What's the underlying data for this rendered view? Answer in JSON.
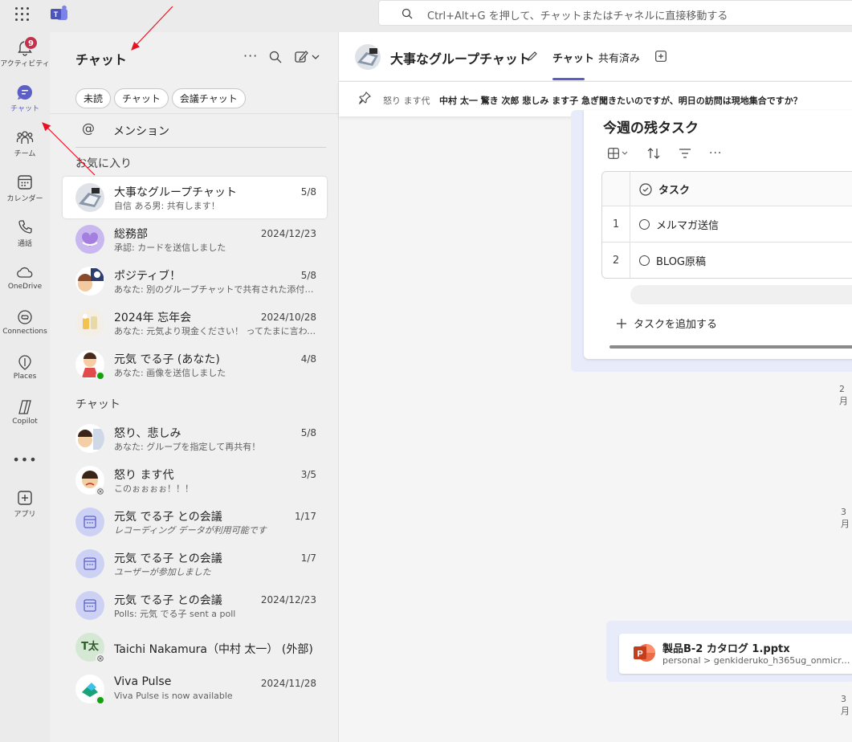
{
  "search": {
    "placeholder": "Ctrl+Alt+G を押して、チャットまたはチャネルに直接移動する"
  },
  "rail": {
    "activity": {
      "label": "アクティビティ",
      "badge": "9"
    },
    "chat": {
      "label": "チャット"
    },
    "teams": {
      "label": "チーム"
    },
    "calendar": {
      "label": "カレンダー"
    },
    "calls": {
      "label": "通話"
    },
    "onedrive": {
      "label": "OneDrive"
    },
    "connections": {
      "label": "Connections"
    },
    "places": {
      "label": "Places"
    },
    "copilot": {
      "label": "Copilot"
    },
    "more": "•••",
    "apps": {
      "label": "アプリ"
    }
  },
  "chatpane": {
    "title": "チャット",
    "filters": [
      "未読",
      "チャット",
      "会議チャット"
    ],
    "mention": "メンション",
    "favorites_label": "お気に入り",
    "chats_label": "チャット",
    "favorites": [
      {
        "name": "大事なグループチャット",
        "date": "5/8",
        "preview": "自信 ある男: 共有します！"
      },
      {
        "name": "総務部",
        "date": "2024/12/23",
        "preview": "承認: カードを送信しました"
      },
      {
        "name": "ポジティブ！",
        "date": "5/8",
        "preview": "あなた: 別のグループチャットで共有された添付ファイ..."
      },
      {
        "name": "2024年 忘年会",
        "date": "2024/10/28",
        "preview": "あなた: 元気より現金ください！ ってたまに言われる..."
      },
      {
        "name": "元気 でる子 (あなた)",
        "date": "4/8",
        "preview": "あなた: 画像を送信しました"
      }
    ],
    "chats": [
      {
        "name": "怒り、悲しみ",
        "date": "5/8",
        "preview": "あなた: グループを指定して再共有！"
      },
      {
        "name": "怒り ます代",
        "date": "3/5",
        "preview": "このぉぉぉぉ！！！"
      },
      {
        "name": "元気 でる子 との会議",
        "date": "1/17",
        "preview": "レコーディング データが利用可能です"
      },
      {
        "name": "元気 でる子 との会議",
        "date": "1/7",
        "preview": "ユーザーが参加しました"
      },
      {
        "name": "元気 でる子 との会議",
        "date": "2024/12/23",
        "preview": "Polls: 元気 でる子 sent a poll"
      },
      {
        "name": "Taichi Nakamura（中村 太一） (外部)",
        "date": "",
        "preview": "",
        "initials": "T太"
      },
      {
        "name": "Viva Pulse",
        "date": "2024/11/28",
        "preview": "Viva Pulse is now available"
      }
    ]
  },
  "main": {
    "title": "大事なグループチャット",
    "tabs": [
      "チャット",
      "共有済み"
    ],
    "pinned": {
      "sender": "怒り ます代",
      "text": "中村 太一 驚き 次郎 悲しみ ます子 急ぎ聞きたいのですが、明日の訪問は現地集合ですか？"
    },
    "loop": {
      "title": "今週の残タスク",
      "column": "タスク",
      "rows": [
        {
          "num": "1",
          "task": "メルマガ送信"
        },
        {
          "num": "2",
          "task": "BLOG原稿"
        }
      ],
      "add_task": "タスクを追加する"
    },
    "dates": [
      "2月",
      "3月",
      "3月"
    ],
    "file": {
      "name": "製品B-2 カタログ 1.pptx",
      "path": "personal > genkideruko_h365ug_onmicros..."
    }
  },
  "colors": {
    "accent": "#5b5fc7",
    "badge": "#c4314b",
    "available": "#13a10e",
    "arrow": "#e81123"
  }
}
